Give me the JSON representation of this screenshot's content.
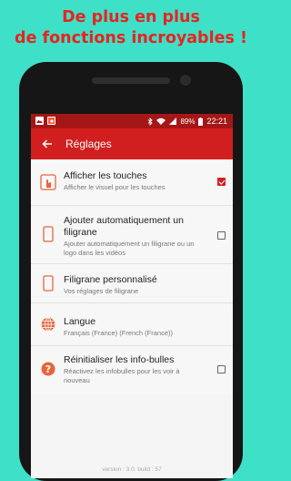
{
  "promo": {
    "line1": "De plus en plus",
    "line2": "de fonctions incroyables !"
  },
  "status": {
    "battery": "89%",
    "time": "22:21"
  },
  "appbar": {
    "title": "Réglages"
  },
  "settings": [
    {
      "title": "Afficher les touches",
      "subtitle": "Afficher le visuel pour les touches",
      "checked": true,
      "icon": "touch-icon"
    },
    {
      "title": "Ajouter automatiquement un filigrane",
      "subtitle": "Ajouter automatiquement un filigrane ou un logo dans les vidéos",
      "checked": false,
      "icon": "phone-icon"
    },
    {
      "title": "Filigrane personnalisé",
      "subtitle": "Vos réglages de filigrane",
      "icon": "phone-icon"
    },
    {
      "title": "Langue",
      "subtitle": "Français (France) (French (France))",
      "icon": "globe-icon"
    },
    {
      "title": "Réinitialiser les info-bulles",
      "subtitle": "Réactivez les infobulles pour les voir à nouveau",
      "checked": false,
      "icon": "help-icon"
    }
  ],
  "version": "version : 3.0. build : 57",
  "colors": {
    "accent": "#d11f1f",
    "statusbar": "#a51717",
    "background": "#3fe0c8",
    "promo": "#e8231f",
    "icon": "#e9643c"
  }
}
